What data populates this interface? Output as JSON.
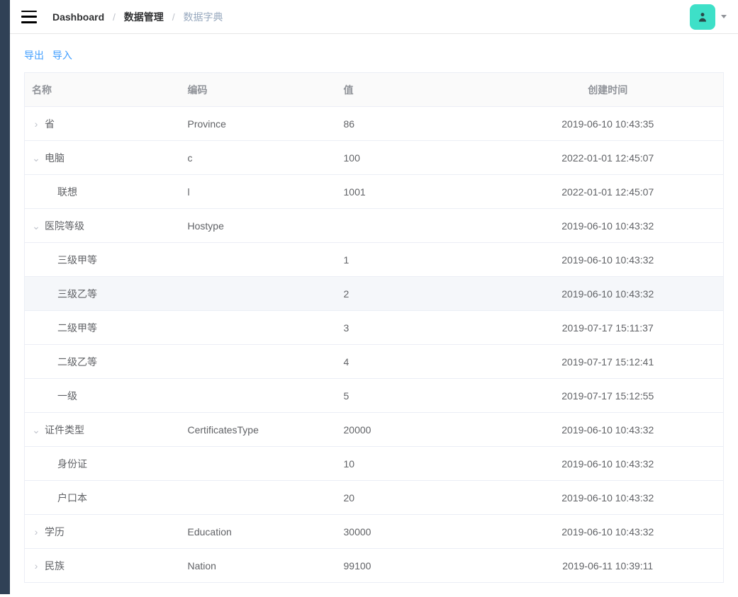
{
  "breadcrumb": {
    "item0": "Dashboard",
    "item1": "数据管理",
    "item2": "数据字典"
  },
  "actions": {
    "export": "导出",
    "import": "导入"
  },
  "table": {
    "headers": {
      "name": "名称",
      "code": "编码",
      "value": "值",
      "time": "创建时间"
    },
    "rows": [
      {
        "level": 0,
        "expand": "right",
        "name": "省",
        "code": "Province",
        "value": "86",
        "time": "2019-06-10 10:43:35"
      },
      {
        "level": 0,
        "expand": "down",
        "name": "电脑",
        "code": "c",
        "value": "100",
        "time": "2022-01-01 12:45:07"
      },
      {
        "level": 1,
        "expand": "none",
        "name": "联想",
        "code": "l",
        "value": "1001",
        "time": "2022-01-01 12:45:07"
      },
      {
        "level": 0,
        "expand": "down",
        "name": "医院等级",
        "code": "Hostype",
        "value": "",
        "time": "2019-06-10 10:43:32"
      },
      {
        "level": 1,
        "expand": "none",
        "name": "三级甲等",
        "code": "",
        "value": "1",
        "time": "2019-06-10 10:43:32"
      },
      {
        "level": 1,
        "expand": "none",
        "hover": true,
        "name": "三级乙等",
        "code": "",
        "value": "2",
        "time": "2019-06-10 10:43:32"
      },
      {
        "level": 1,
        "expand": "none",
        "name": "二级甲等",
        "code": "",
        "value": "3",
        "time": "2019-07-17 15:11:37"
      },
      {
        "level": 1,
        "expand": "none",
        "name": "二级乙等",
        "code": "",
        "value": "4",
        "time": "2019-07-17 15:12:41"
      },
      {
        "level": 1,
        "expand": "none",
        "name": "一级",
        "code": "",
        "value": "5",
        "time": "2019-07-17 15:12:55"
      },
      {
        "level": 0,
        "expand": "down",
        "name": "证件类型",
        "code": "CertificatesType",
        "value": "20000",
        "time": "2019-06-10 10:43:32"
      },
      {
        "level": 1,
        "expand": "none",
        "name": "身份证",
        "code": "",
        "value": "10",
        "time": "2019-06-10 10:43:32"
      },
      {
        "level": 1,
        "expand": "none",
        "name": "户口本",
        "code": "",
        "value": "20",
        "time": "2019-06-10 10:43:32"
      },
      {
        "level": 0,
        "expand": "right",
        "name": "学历",
        "code": "Education",
        "value": "30000",
        "time": "2019-06-10 10:43:32"
      },
      {
        "level": 0,
        "expand": "right",
        "name": "民族",
        "code": "Nation",
        "value": "99100",
        "time": "2019-06-11 10:39:11"
      }
    ]
  }
}
